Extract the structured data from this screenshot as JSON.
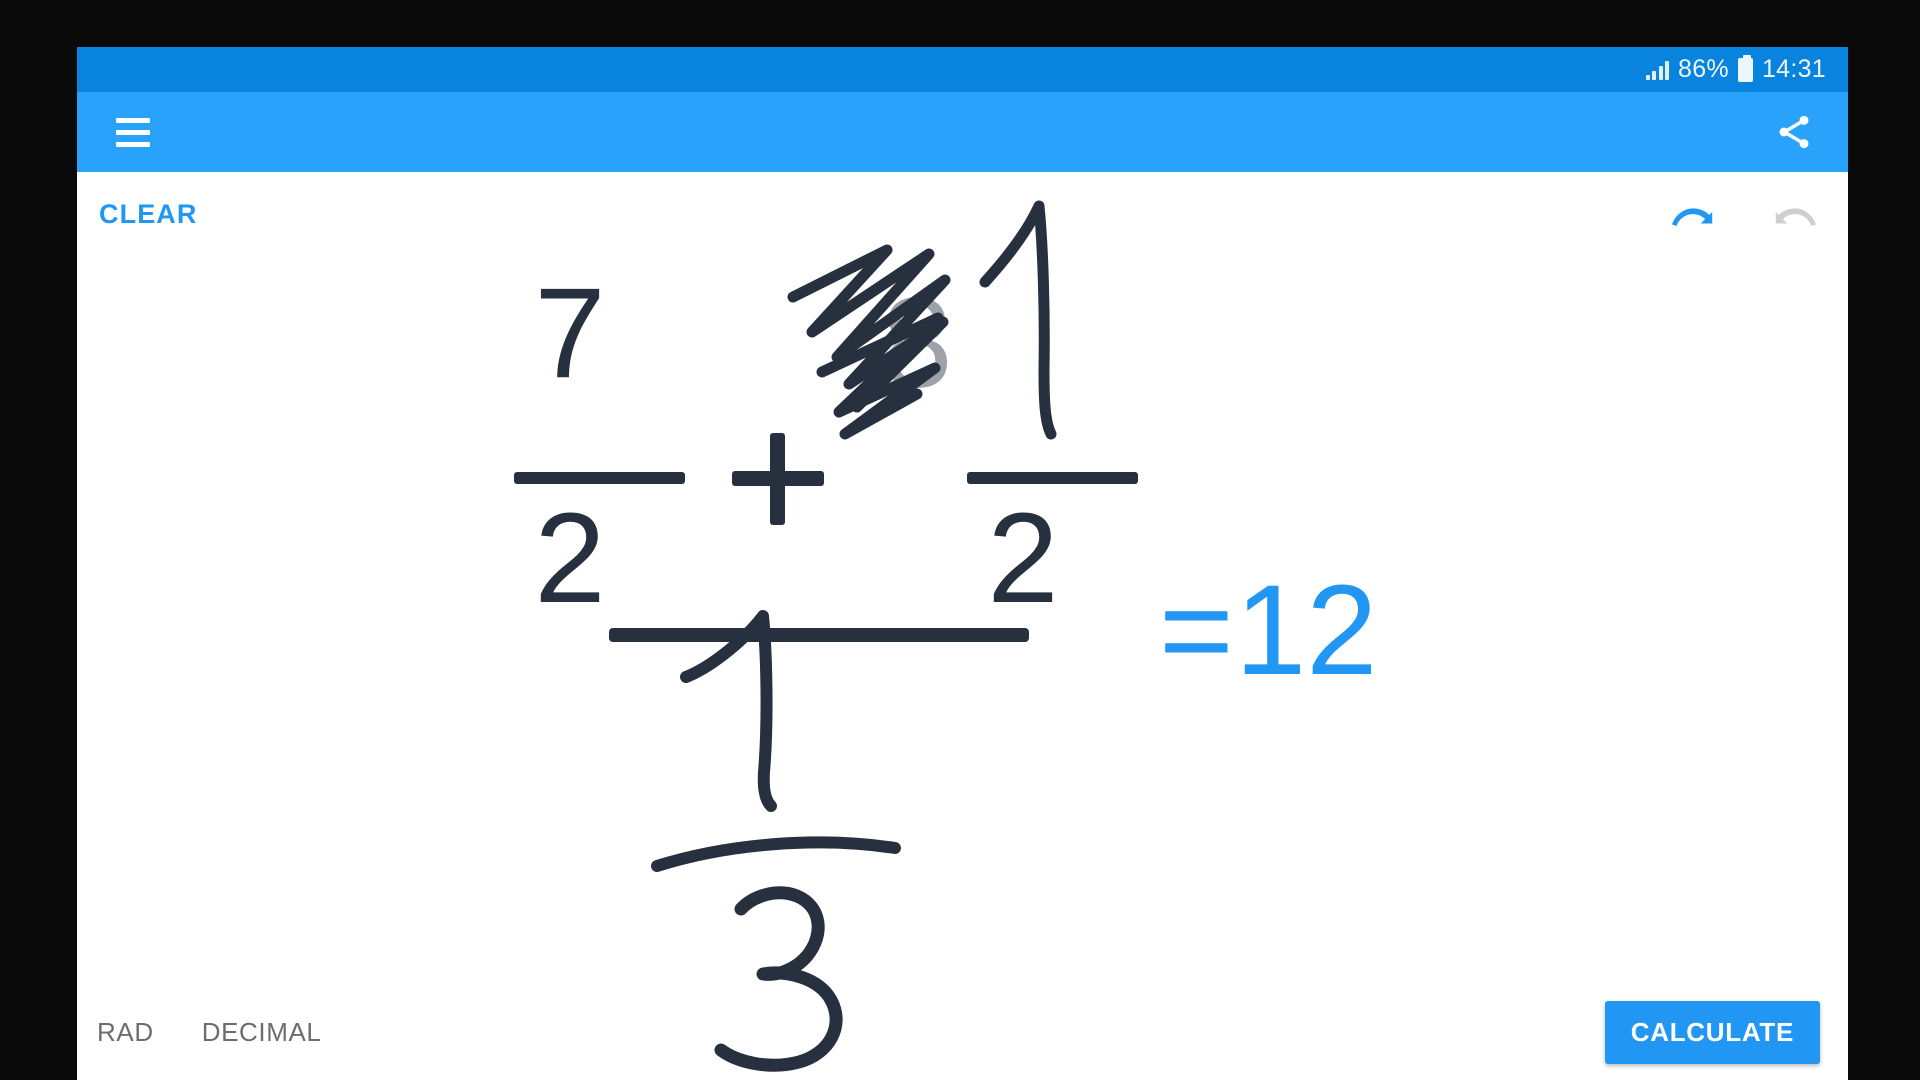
{
  "app": {
    "window_background": "#ffffff",
    "accent_color": "#2196f3",
    "appbar_color": "#29a2fb",
    "statusbar_color": "#0984de",
    "ink_color": "#27303f",
    "faded_ink_color": "#aaaeb5"
  },
  "status_bar": {
    "signal_icon": "signal-bars-icon",
    "battery_percent": "86%",
    "battery_icon": "battery-icon",
    "clock": "14:31"
  },
  "app_bar": {
    "menu_icon": "hamburger-menu-icon",
    "share_icon": "share-icon"
  },
  "canvas_toolbar": {
    "clear_label": "CLEAR",
    "undo_icon": "undo-arrow-icon",
    "undo_enabled": true,
    "redo_icon": "redo-arrow-icon",
    "redo_enabled": false
  },
  "equation": {
    "description": "Complex fraction: (7/2 + 1/2) over 1/3, with the second numerator scribbled out and rewritten",
    "numerator": {
      "left_fraction": {
        "numerator": "7",
        "denominator": "2"
      },
      "operator": "+",
      "right_fraction": {
        "numerator_struck_out": "8",
        "numerator_handwritten": "1",
        "denominator": "2"
      }
    },
    "denominator": {
      "numerator_handwritten": "1",
      "denominator_handwritten": "3"
    },
    "equals_sign": "=",
    "result": "12"
  },
  "bottom_bar": {
    "angle_mode_label": "RAD",
    "number_mode_label": "DECIMAL",
    "calculate_label": "CALCULATE"
  }
}
